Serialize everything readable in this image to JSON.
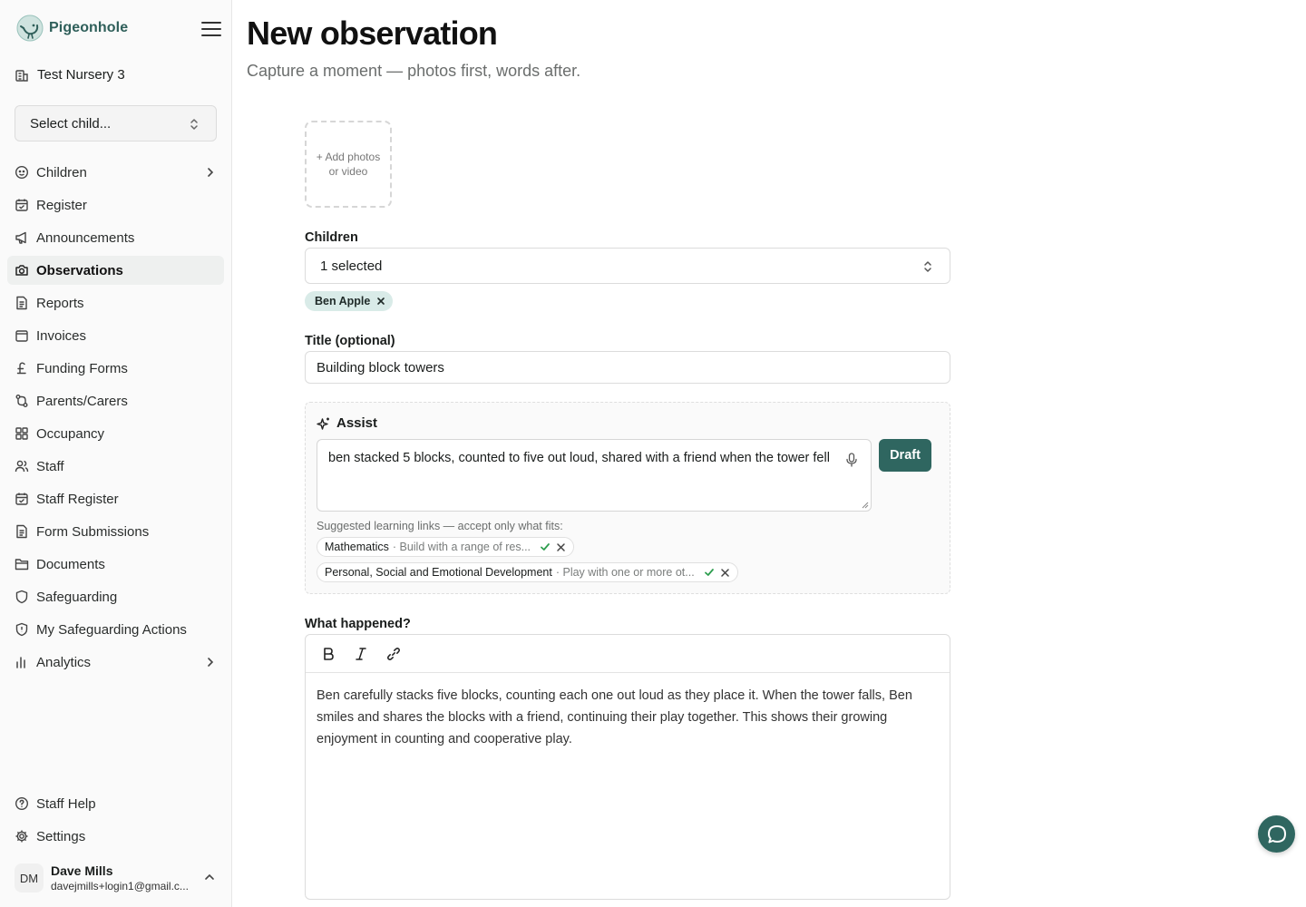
{
  "app": {
    "name": "Pigeonhole"
  },
  "sidebar": {
    "nursery": "Test Nursery 3",
    "child_select_placeholder": "Select child...",
    "items": [
      {
        "label": "Children",
        "icon": "child-face-icon",
        "chevron": true
      },
      {
        "label": "Register",
        "icon": "calendar-check-icon"
      },
      {
        "label": "Announcements",
        "icon": "megaphone-icon"
      },
      {
        "label": "Observations",
        "icon": "camera-icon",
        "active": true
      },
      {
        "label": "Reports",
        "icon": "document-icon"
      },
      {
        "label": "Invoices",
        "icon": "wallet-icon"
      },
      {
        "label": "Funding Forms",
        "icon": "pound-icon"
      },
      {
        "label": "Parents/Carers",
        "icon": "git-compare-icon"
      },
      {
        "label": "Occupancy",
        "icon": "grid-icon"
      },
      {
        "label": "Staff",
        "icon": "users-icon"
      },
      {
        "label": "Staff Register",
        "icon": "calendar-check-icon"
      },
      {
        "label": "Form Submissions",
        "icon": "document-icon"
      },
      {
        "label": "Documents",
        "icon": "folder-icon"
      },
      {
        "label": "Safeguarding",
        "icon": "shield-icon"
      },
      {
        "label": "My Safeguarding Actions",
        "icon": "shield-alert-icon"
      },
      {
        "label": "Analytics",
        "icon": "bar-chart-icon",
        "chevron": true
      }
    ],
    "bottom_items": [
      {
        "label": "Staff Help",
        "icon": "help-circle-icon"
      },
      {
        "label": "Settings",
        "icon": "gear-icon"
      }
    ],
    "user": {
      "initials": "DM",
      "name": "Dave Mills",
      "email": "davejmills+login1@gmail.c..."
    }
  },
  "main": {
    "title": "New observation",
    "subtitle": "Capture a moment — photos first, words after.",
    "add_media_label": "+ Add photos or video",
    "children_label": "Children",
    "children_select_value": "1 selected",
    "selected_children": [
      "Ben Apple"
    ],
    "title_label": "Title (optional)",
    "title_value": "Building block towers",
    "assist": {
      "heading": "Assist",
      "input_value": "ben stacked 5 blocks, counted to five out loud, shared with a friend when the tower fell",
      "draft_label": "Draft",
      "suggestions_label": "Suggested learning links — accept only what fits:",
      "suggestions": [
        {
          "area": "Mathematics",
          "desc": "· Build with a range of res..."
        },
        {
          "area": "Personal, Social and Emotional Development",
          "desc": "· Play with one or more ot..."
        }
      ]
    },
    "what_happened_label": "What happened?",
    "what_happened_text": "Ben carefully stacks five blocks, counting each one out loud as they place it. When the tower falls, Ben smiles and shares the blocks with a friend, continuing their play together. This shows their growing enjoyment in counting and cooperative play."
  },
  "colors": {
    "accent": "#2f6660",
    "chip_bg": "#d9ebe8",
    "brand_text": "#2f5f5a",
    "accept_green": "#2e9e4f"
  }
}
